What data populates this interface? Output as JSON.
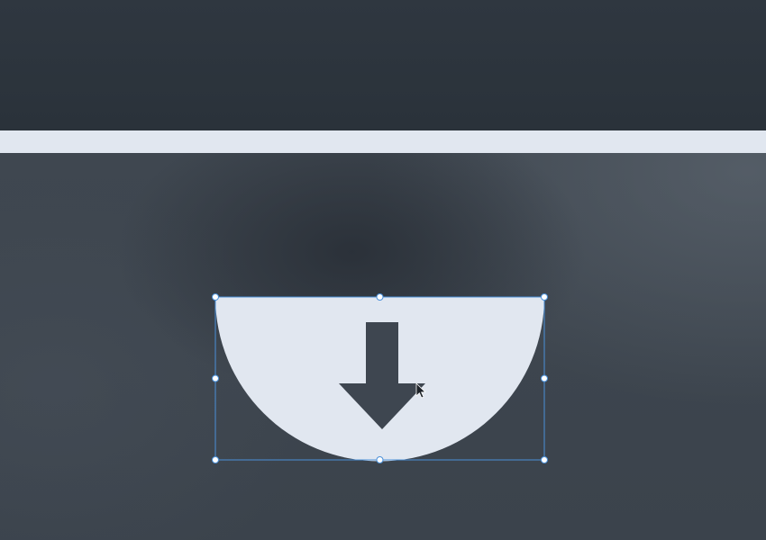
{
  "canvas": {
    "top_band_color": "#2c343c",
    "divider_color": "#e1e7f0",
    "background_color": "#3f4750"
  },
  "shape": {
    "name": "semicircle-with-download-arrow",
    "fill_color": "#e1e7f0",
    "arrow_color": "#3e4650",
    "icon": "arrow-down-icon"
  },
  "selection": {
    "outline_color": "#4a90d9",
    "handle_fill": "#ffffff",
    "handle_count": 8
  },
  "cursor": {
    "icon": "mouse-pointer-icon"
  }
}
